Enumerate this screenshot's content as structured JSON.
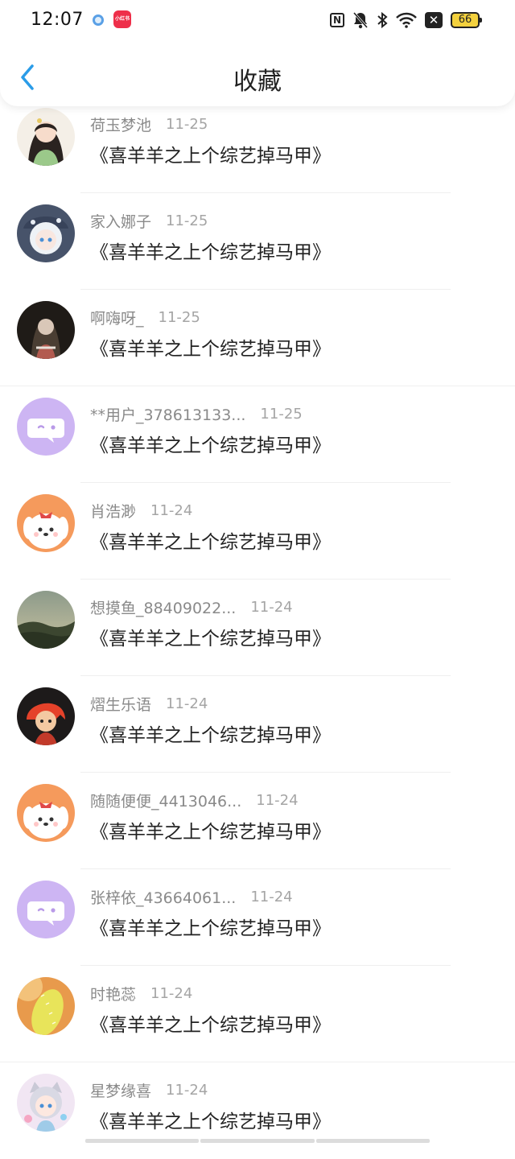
{
  "status_bar": {
    "time": "12:07",
    "app2_label": "小红书",
    "battery": "66"
  },
  "header": {
    "title": "收藏"
  },
  "items": [
    {
      "username": "荷玉梦池",
      "date": "11-25",
      "title": "《喜羊羊之上个综艺掉马甲》",
      "avatar_icon": "anime-girl-green-avatar"
    },
    {
      "username": "家入娜子",
      "date": "11-25",
      "title": "《喜羊羊之上个综艺掉马甲》",
      "avatar_icon": "anime-white-hair-avatar"
    },
    {
      "username": "啊嗨呀_",
      "date": "11-25",
      "title": "《喜羊羊之上个综艺掉马甲》",
      "avatar_icon": "dark-portrait-avatar"
    },
    {
      "username": "**用户_378613133...",
      "date": "11-25",
      "title": "《喜羊羊之上个综艺掉马甲》",
      "avatar_icon": "default-chat-bubble-avatar"
    },
    {
      "username": "肖浩渺",
      "date": "11-24",
      "title": "《喜羊羊之上个综艺掉马甲》",
      "avatar_icon": "cute-dog-avatar"
    },
    {
      "username": "想摸鱼_88409022...",
      "date": "11-24",
      "title": "《喜羊羊之上个综艺掉马甲》",
      "avatar_icon": "landscape-avatar"
    },
    {
      "username": "熠生乐语",
      "date": "11-24",
      "title": "《喜羊羊之上个综艺掉马甲》",
      "avatar_icon": "cartoon-redhead-avatar"
    },
    {
      "username": "随随便便_4413046...",
      "date": "11-24",
      "title": "《喜羊羊之上个综艺掉马甲》",
      "avatar_icon": "cute-dog-avatar"
    },
    {
      "username": "张梓依_43664061...",
      "date": "11-24",
      "title": "《喜羊羊之上个综艺掉马甲》",
      "avatar_icon": "default-chat-bubble-avatar"
    },
    {
      "username": "时艳蕊",
      "date": "11-24",
      "title": "《喜羊羊之上个综艺掉马甲》",
      "avatar_icon": "cactus-avatar"
    },
    {
      "username": "星梦缘喜",
      "date": "11-24",
      "title": "《喜羊羊之上个综艺掉马甲》",
      "avatar_icon": "anime-cat-girl-avatar"
    }
  ],
  "colors": {
    "accent": "#2a9ce8",
    "default_avatar_bg": "#cdb5f3"
  }
}
